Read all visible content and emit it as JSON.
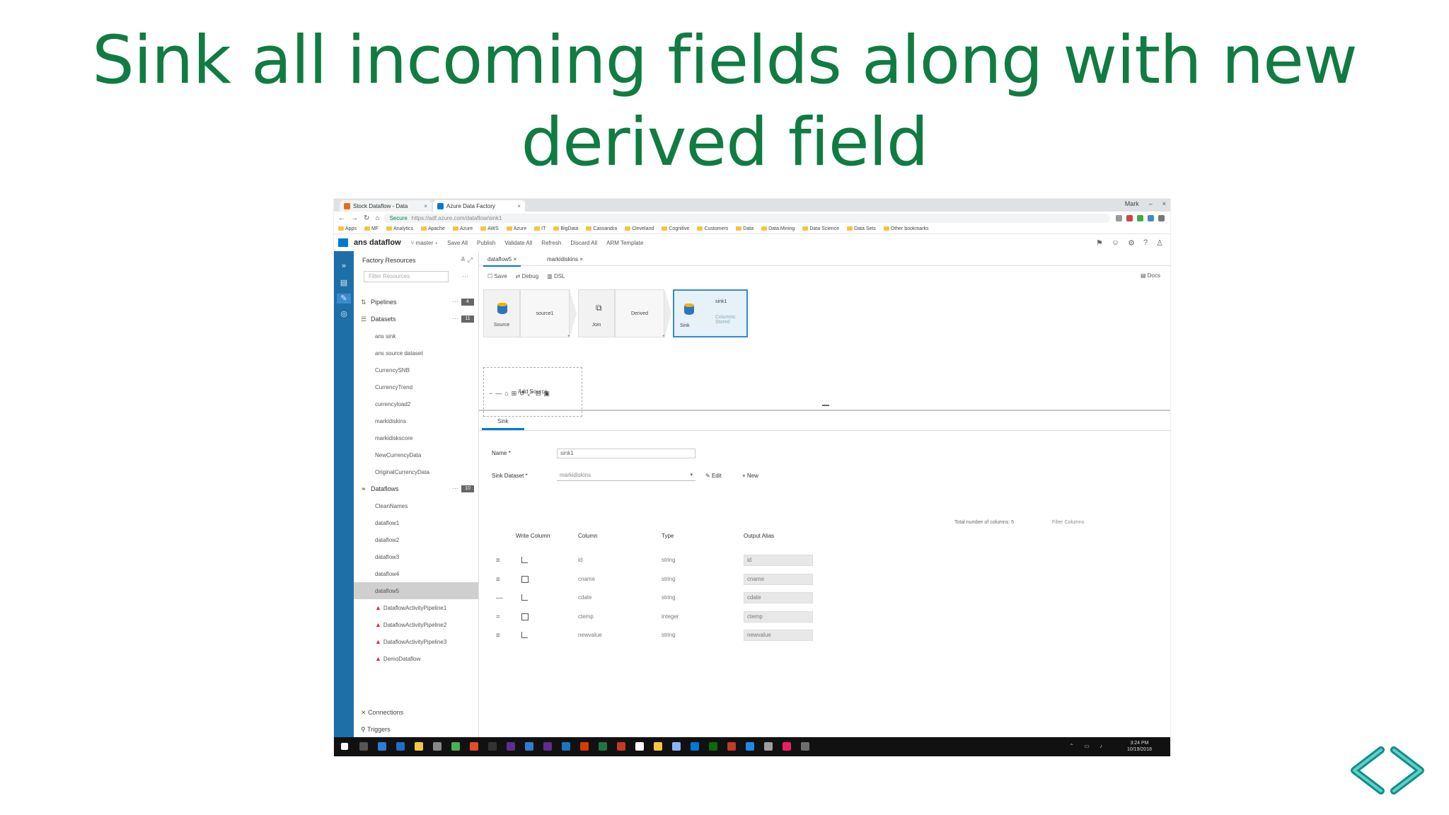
{
  "slide": {
    "title_line1": "Sink all incoming fields along with new",
    "title_line2": "derived field"
  },
  "browser": {
    "tabs": [
      "Stock Dataflow - Data",
      "Azure Data Factory"
    ],
    "url": "https://adf.azure.com/dataflow/sink1",
    "secure_label": "Secure",
    "user": "Mark",
    "bookmarks": [
      "Apps",
      "MF",
      "Analytics",
      "Apache",
      "Azure",
      "AWS",
      "Azure",
      "IT",
      "BigData",
      "Cassandra",
      "Cleveland",
      "Cognitive",
      "Customers",
      "Data",
      "Data Mining",
      "Data Science",
      "Data Sets",
      "Other bookmarks"
    ]
  },
  "adf_header": {
    "title": "ans dataflow",
    "branch": "master",
    "items": [
      "Save All",
      "Publish",
      "Validate All",
      "Refresh",
      "Discard All",
      "ARM Template"
    ]
  },
  "resources": {
    "title": "Factory Resources",
    "search_placeholder": "Filter Resources",
    "groups": [
      {
        "label": "Pipelines",
        "count": "4"
      },
      {
        "label": "Datasets",
        "count": "11"
      }
    ],
    "datasets": [
      "ans sink",
      "ans source dataset",
      "CurrencySNB",
      "CurrencyTrend",
      "currencyload2",
      "markidiskins",
      "markidiskscore",
      "NewCurrencyData",
      "OriginalCurrencyData"
    ],
    "dataflows_group": {
      "label": "Dataflows",
      "count": "10"
    },
    "dataflows": [
      "CleanNames",
      "dataflow1",
      "dataflow2",
      "dataflow3",
      "dataflow4",
      "dataflow5"
    ],
    "dataflows_with_warnings": [
      "DataflowActivityPipeline1",
      "DataflowActivityPipeline2",
      "DataflowActivityPipeline3",
      "DemoDataflow"
    ],
    "selected": "dataflow5",
    "bottom": [
      "Connections",
      "Triggers"
    ]
  },
  "main": {
    "doc_tabs": [
      "dataflow5",
      "markidiskins"
    ],
    "toolbar": [
      "Save",
      "Debug",
      "DSL"
    ],
    "toolbar_right": "Docs",
    "nodes": {
      "source_label": "Source",
      "source_name": "source1",
      "join_label": "Join",
      "join_name": "Derived",
      "sink_label": "Sink",
      "sink_name": "sink1",
      "sink_sub": "Columns: Stored"
    },
    "add_source": "Add Source",
    "prop_tab": "Sink",
    "name_label": "Name *",
    "name_value": "sink1",
    "dataset_label": "Sink Dataset *",
    "dataset_value": "markidiskins",
    "edit_label": "Edit",
    "new_label": "New",
    "total_columns": "Total number of columns: 5",
    "filter_columns": "Filter Columns",
    "grid": {
      "headers": [
        "Write Column",
        "Column",
        "Type",
        "Output Alias"
      ],
      "rows": [
        {
          "column": "id",
          "type": "string",
          "alias": "id"
        },
        {
          "column": "cname",
          "type": "string",
          "alias": "cname"
        },
        {
          "column": "cdate",
          "type": "string",
          "alias": "cdate"
        },
        {
          "column": "ctemp",
          "type": "integer",
          "alias": "ctemp"
        },
        {
          "column": "newvalue",
          "type": "string",
          "alias": "newvalue"
        }
      ]
    }
  },
  "taskbar": {
    "time": "3:24 PM",
    "date": "10/19/2018"
  },
  "colors": {
    "title_green": "#107c41",
    "adf_blue": "#1e6fa8",
    "sink_border": "#2f8dcc",
    "nav_arrow": "#17a2a0"
  },
  "icons": [
    "nav-left-arrow-icon",
    "nav-right-arrow-icon"
  ]
}
